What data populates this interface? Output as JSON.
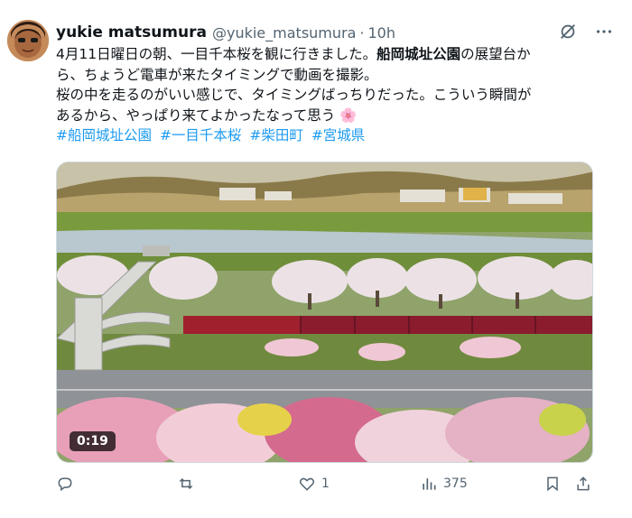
{
  "tweet": {
    "display_name": "yukie matsumura",
    "handle": "@yukie_matsumura",
    "separator": "·",
    "time": "10h",
    "text_line1_a": "4月11日曜日の朝、一目千本桜を観に行きました。",
    "text_line1_bold": "船岡城址公園",
    "text_line1_b": "の展望台か",
    "text_line2": "ら、ちょうど電車が来たタイミングで動画を撮影。",
    "text_line3": "桜の中を走るのがいい感じで、タイミングばっちりだった。こういう瞬間が",
    "text_line4": "あるから、やっぱり来てよかったなって思う",
    "emoji": "🌸",
    "hashtags": [
      "#船岡城址公園",
      "#一目千本桜",
      "#柴田町",
      "#宮城県"
    ]
  },
  "media": {
    "duration": "0:19"
  },
  "actions": {
    "reply_count": "",
    "retweet_count": "",
    "like_count": "1",
    "views_count": "375"
  },
  "icons": {
    "grok": "grok-icon",
    "more": "more-icon",
    "reply": "reply-icon",
    "retweet": "retweet-icon",
    "like": "heart-icon",
    "views": "analytics-icon",
    "bookmark": "bookmark-icon",
    "share": "share-icon"
  },
  "colors": {
    "link": "#1d9bf0",
    "muted": "#536471",
    "train": "#8a1c2e"
  }
}
